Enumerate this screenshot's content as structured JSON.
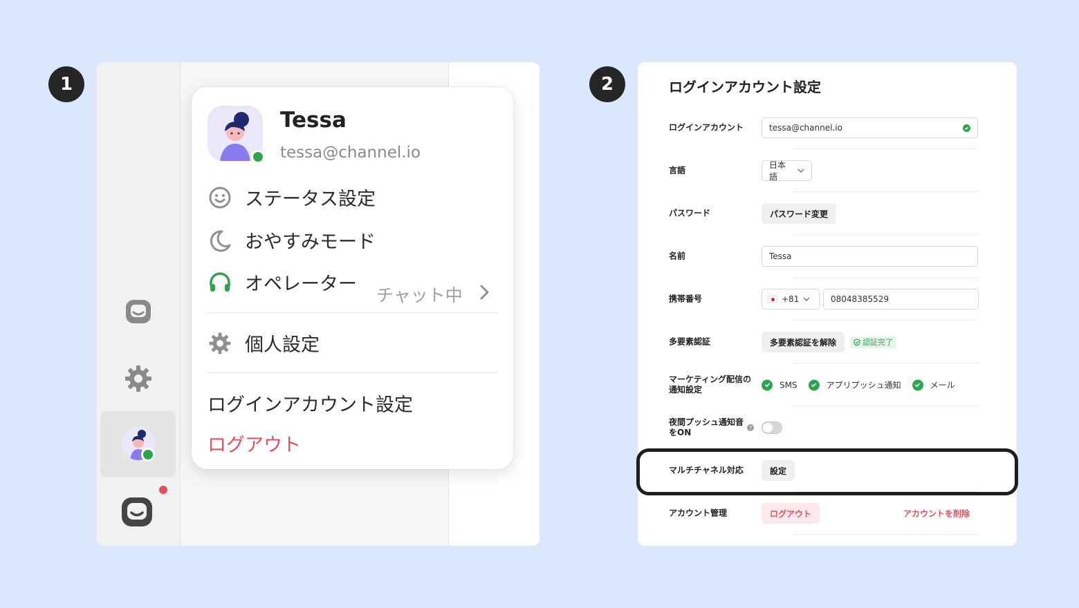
{
  "badges": {
    "one": "1",
    "two": "2"
  },
  "menu": {
    "name": "Tessa",
    "email": "tessa@channel.io",
    "status_label": "ステータス設定",
    "sleep_label": "おやすみモード",
    "operator_label": "オペレーター",
    "operator_status": "チャット中",
    "personal_label": "個人設定",
    "login_settings_label": "ログインアカウント設定",
    "logout_label": "ログアウト"
  },
  "settings": {
    "title": "ログインアカウント設定",
    "login_account": {
      "label": "ログインアカウント",
      "value": "tessa@channel.io"
    },
    "language": {
      "label": "言語",
      "value": "日本語"
    },
    "password": {
      "label": "パスワード",
      "button": "パスワード変更"
    },
    "name": {
      "label": "名前",
      "value": "Tessa"
    },
    "phone": {
      "label": "携帯番号",
      "country_code": "+81",
      "number": "08048385529"
    },
    "mfa": {
      "label": "多要素認証",
      "button": "多要素認証を解除",
      "badge": "認証完了"
    },
    "marketing": {
      "label": "マーケティング配信の通知設定",
      "options": [
        "SMS",
        "アプリプッシュ通知",
        "メール"
      ]
    },
    "night_push": {
      "label": "夜間プッシュ通知音をON",
      "help": "?"
    },
    "multichannel": {
      "label": "マルチチャネル対応",
      "button": "設定"
    },
    "account": {
      "label": "アカウント管理",
      "logout": "ログアウト",
      "delete": "アカウントを削除"
    }
  },
  "colors": {
    "background": "#dbe7fd",
    "accent_red": "#e0505d",
    "online_green": "#2da44e"
  }
}
